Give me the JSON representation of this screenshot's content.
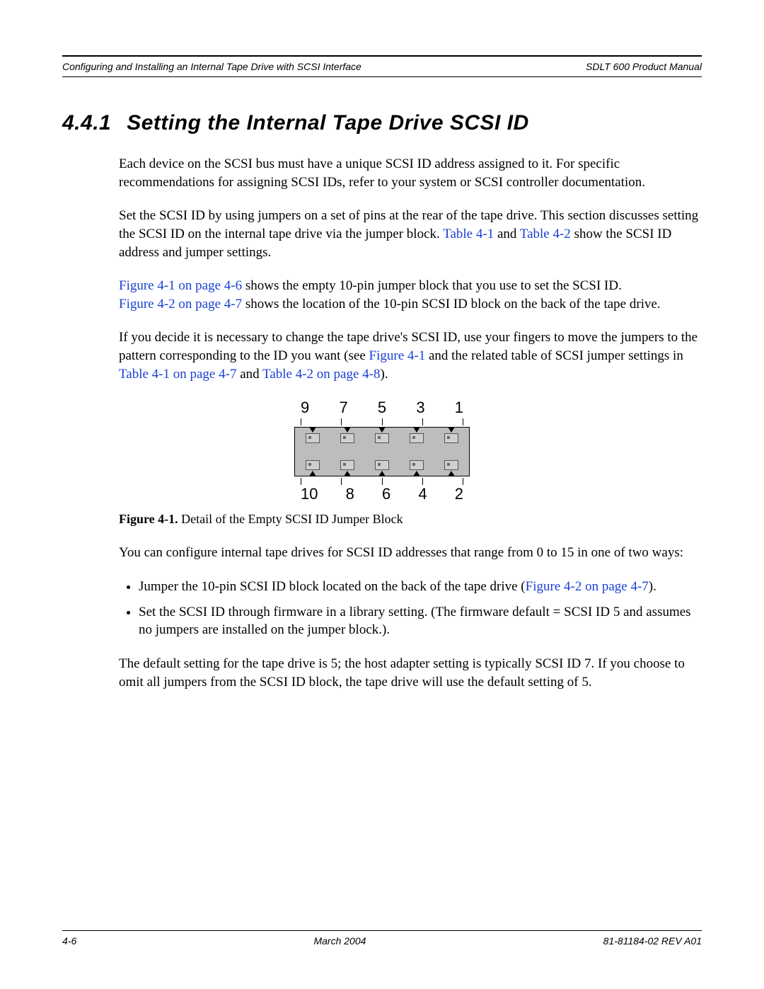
{
  "header": {
    "left": "Configuring and Installing an Internal Tape Drive with SCSI Interface",
    "right": "SDLT 600 Product Manual"
  },
  "section": {
    "number": "4.4.1",
    "title": "Setting the Internal Tape Drive SCSI ID"
  },
  "para1": "Each device on the SCSI bus must have a unique SCSI ID address assigned to it. For specific recommendations for assigning SCSI IDs, refer to your system or SCSI controller documentation.",
  "para2_a": "Set the SCSI ID by using jumpers on a set of pins at the rear of the tape drive. This section discusses setting the SCSI ID on the internal tape drive via the jumper block. ",
  "para2_link1": "Table 4-1",
  "para2_b": " and ",
  "para2_link2": "Table 4-2",
  "para2_c": " show the SCSI ID address and jumper settings.",
  "para3_link1": "Figure 4-1 on page 4-6",
  "para3_a": " shows the empty 10-pin jumper block that you use to set the SCSI ID. ",
  "para3_link2": "Figure 4-2 on page 4-7",
  "para3_b": " shows the location of the 10-pin SCSI ID block on the back of the tape drive.",
  "para4_a": "If you decide it is necessary to change the tape drive's SCSI ID, use your fingers to move the jumpers to the pattern corresponding to the ID you want (see ",
  "para4_link1": "Figure 4-1",
  "para4_b": " and the related table of SCSI jumper settings in ",
  "para4_link2": "Table 4-1 on page 4-7",
  "para4_c": " and ",
  "para4_link3": "Table 4-2 on page 4-8",
  "para4_d": ").",
  "jumper": {
    "top_pins": [
      "9",
      "7",
      "5",
      "3",
      "1"
    ],
    "bottom_pins": [
      "10",
      "8",
      "6",
      "4",
      "2"
    ]
  },
  "figure_caption": {
    "label": "Figure 4-1.",
    "text": "  Detail of the Empty SCSI ID Jumper Block"
  },
  "para5": "You can configure internal tape drives for SCSI ID addresses that range from 0 to 15 in one of two ways:",
  "bullets": {
    "b1_a": "Jumper the 10-pin SCSI ID block located on the back of the tape drive (",
    "b1_link": "Figure 4-2 on page 4-7",
    "b1_b": ").",
    "b2": "Set the SCSI ID through firmware in a library setting. (The firmware default = SCSI ID 5 and assumes no jumpers are installed on the jumper block.)."
  },
  "para6": "The default setting for the tape drive is 5; the host adapter setting is typically SCSI ID 7. If you choose to omit all jumpers from the SCSI ID block, the tape drive will use the default setting of 5.",
  "footer": {
    "left": "4-6",
    "center": "March 2004",
    "right": "81-81184-02 REV A01"
  }
}
